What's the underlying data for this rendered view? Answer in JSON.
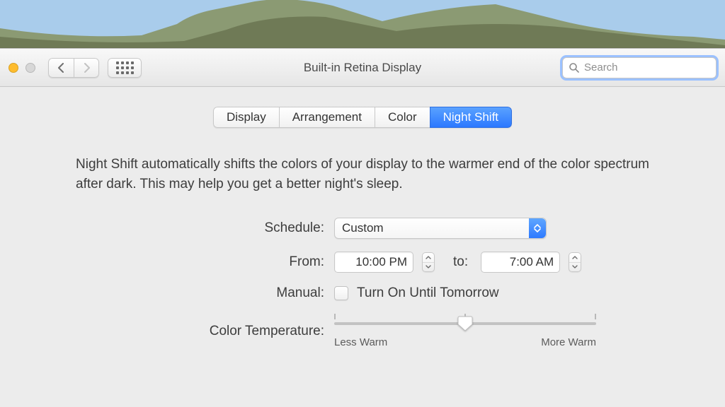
{
  "window": {
    "title": "Built-in Retina Display"
  },
  "search": {
    "placeholder": "Search"
  },
  "tabs": {
    "items": [
      "Display",
      "Arrangement",
      "Color",
      "Night Shift"
    ],
    "active_index": 3
  },
  "description": "Night Shift automatically shifts the colors of your display to the warmer end of the color spectrum after dark. This may help you get a better night's sleep.",
  "schedule": {
    "label": "Schedule:",
    "value": "Custom"
  },
  "time_range": {
    "from_label": "From:",
    "from_value": "10:00 PM",
    "to_label": "to:",
    "to_value": "7:00 AM"
  },
  "manual": {
    "label": "Manual:",
    "checkbox_label": "Turn On Until Tomorrow",
    "checked": false
  },
  "color_temp": {
    "label": "Color Temperature:",
    "less_label": "Less Warm",
    "more_label": "More Warm",
    "value_percent": 50
  }
}
